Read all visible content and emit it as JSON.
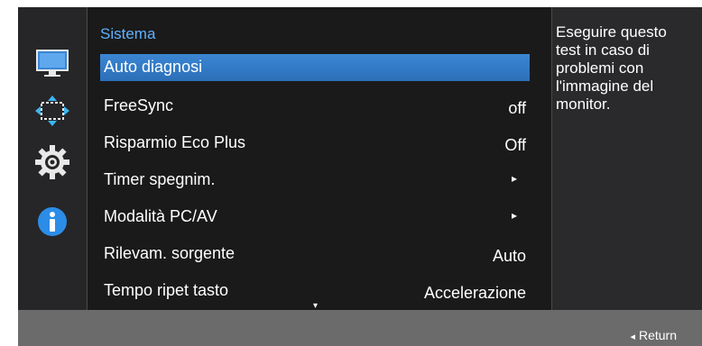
{
  "menu": {
    "title": "Sistema",
    "items": [
      {
        "label": "Auto diagnosi",
        "value": "",
        "selected": true
      },
      {
        "label": "FreeSync",
        "value": "off"
      },
      {
        "label": "Risparmio Eco Plus",
        "value": "Off"
      },
      {
        "label": "Timer spegnim.",
        "value": "▸"
      },
      {
        "label": "Modalità PC/AV",
        "value": "▸"
      },
      {
        "label": "Rilevam. sorgente",
        "value": "Auto"
      },
      {
        "label": "Tempo ripet tasto",
        "value": "Accelerazione"
      }
    ],
    "scroll_indicator": "▾"
  },
  "help": {
    "text": "Eseguire questo test in caso di problemi con l'immagine del monitor."
  },
  "footer": {
    "return_label": "Return",
    "return_icon": "◂"
  },
  "sidebar": {
    "icons": [
      "monitor-icon",
      "screen-adjust-icon",
      "gear-icon",
      "info-icon"
    ],
    "accent": "#3b86d4"
  }
}
